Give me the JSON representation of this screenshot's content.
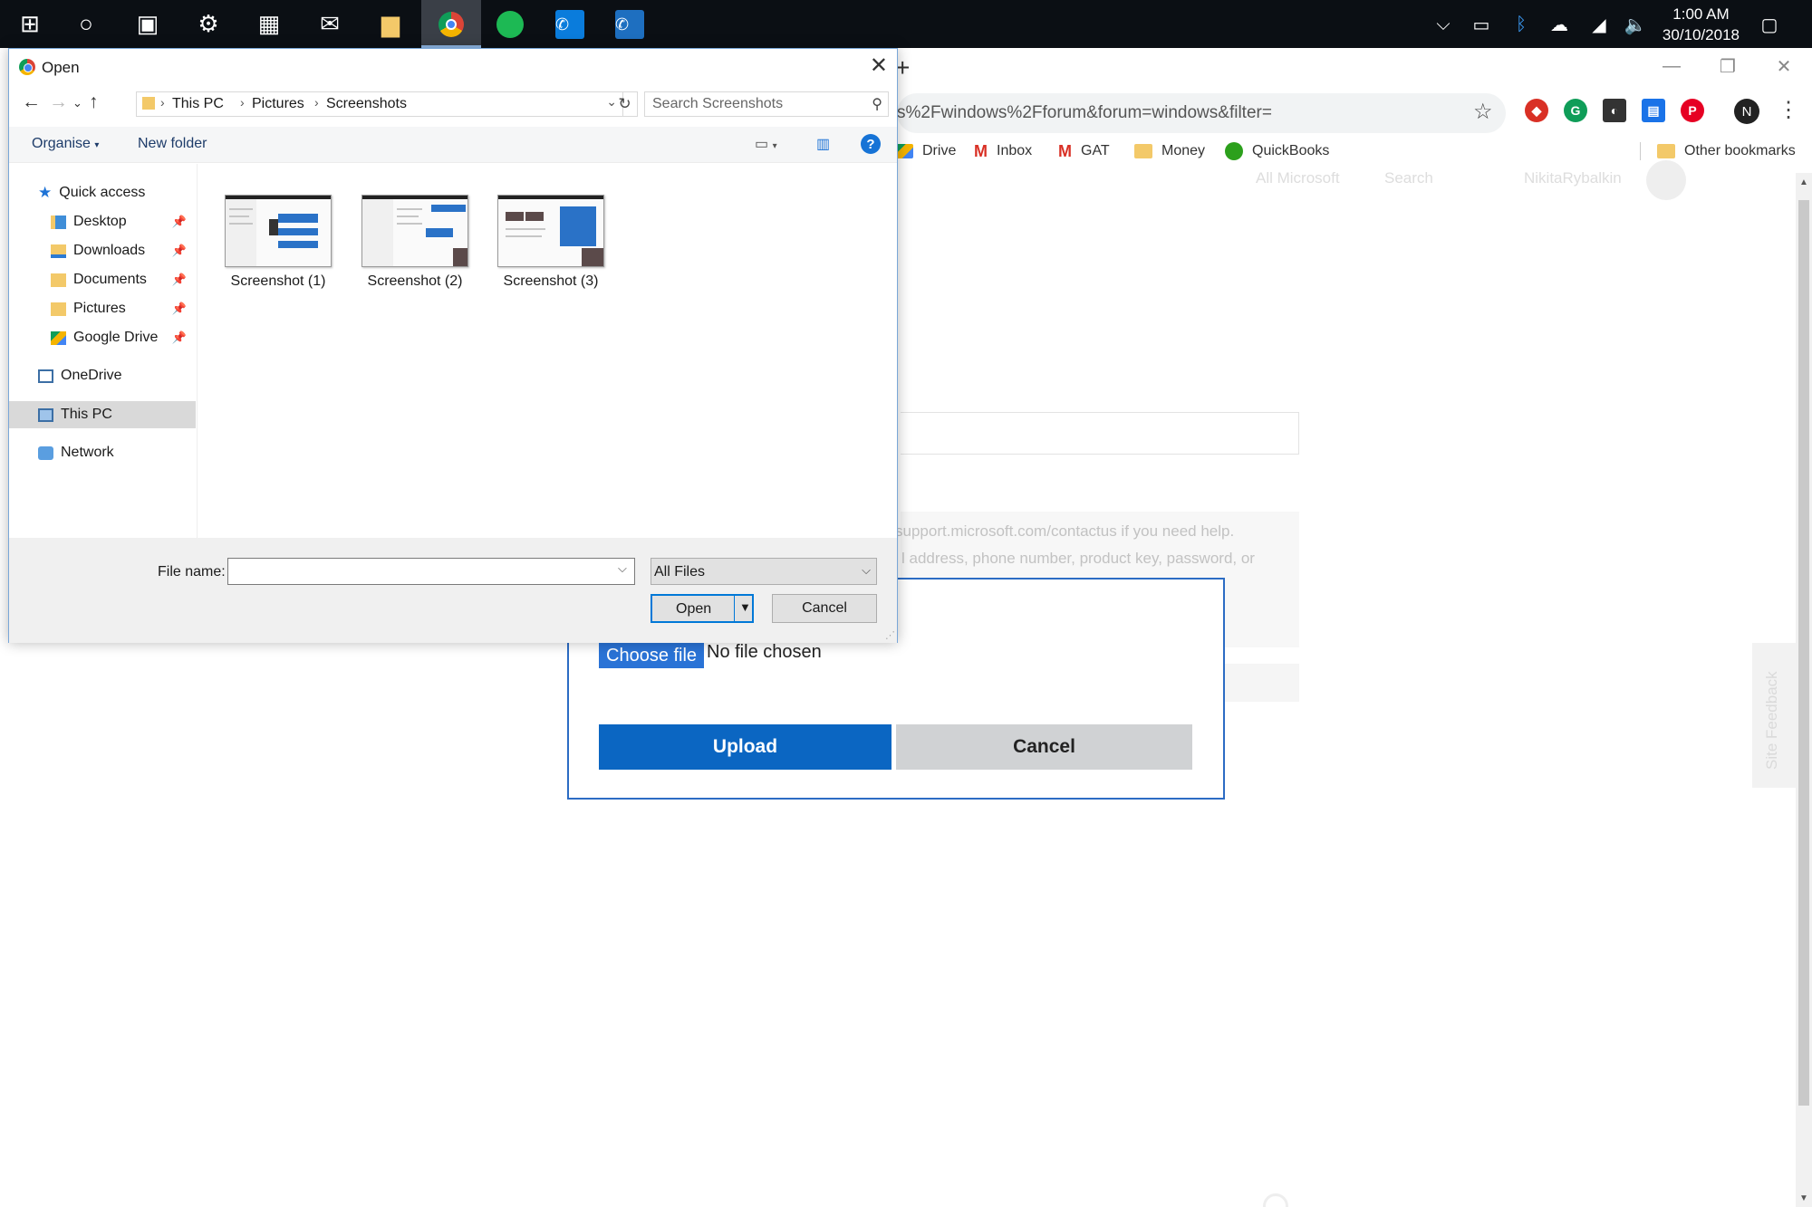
{
  "taskbar": {
    "apps": [
      {
        "name": "windows-start-icon",
        "glyph": "⊞"
      },
      {
        "name": "cortana-icon",
        "glyph": "○"
      },
      {
        "name": "store-icon",
        "glyph": "🛍"
      },
      {
        "name": "settings-icon",
        "glyph": "⚙"
      },
      {
        "name": "calendar-icon",
        "glyph": "▦"
      },
      {
        "name": "mail-icon",
        "glyph": "✉"
      },
      {
        "name": "file-explorer-icon",
        "glyph": "▆"
      },
      {
        "name": "chrome-icon",
        "glyph": "◉"
      },
      {
        "name": "spotify-icon",
        "glyph": "●"
      },
      {
        "name": "messenger-icon",
        "glyph": "✆"
      },
      {
        "name": "whatsapp-icon",
        "glyph": "✆"
      }
    ],
    "clock": {
      "time": "1:00 AM",
      "date": "30/10/2018"
    }
  },
  "browser": {
    "url_fragment": "s%2Fwindows%2Fforum&forum=windows&filter=",
    "avatar_letter": "N",
    "bookmarks": [
      {
        "label": "Drive",
        "icon": "drive-icon"
      },
      {
        "label": "Inbox",
        "icon": "gmail-icon"
      },
      {
        "label": "GAT",
        "icon": "gmail-icon"
      },
      {
        "label": "Money",
        "icon": "folder-icon"
      },
      {
        "label": "QuickBooks",
        "icon": "quickbooks-icon"
      }
    ],
    "other_bookmarks": "Other bookmarks",
    "accent_colors": {
      "extension_red": "#d93025",
      "extension_green": "#0f9d58",
      "extension_blue": "#1a73e8",
      "pinterest": "#e60023"
    }
  },
  "page": {
    "nav_all_microsoft": "All Microsoft",
    "nav_search": "Search",
    "nav_user": "NikitaRybalkin",
    "help_line1": "support.microsoft.com/contactus if you need help.",
    "help_line2": "l address, phone number, product key, password, or",
    "site_feedback": "Site Feedback"
  },
  "upload_dialog": {
    "choose_file": "Choose file",
    "no_file": "No file chosen",
    "upload": "Upload",
    "cancel": "Cancel"
  },
  "open_dialog": {
    "title": "Open",
    "breadcrumb": [
      "This PC",
      "Pictures",
      "Screenshots"
    ],
    "search_placeholder": "Search Screenshots",
    "organise": "Organise",
    "new_folder": "New folder",
    "nav": {
      "quick_access": "Quick access",
      "desktop": "Desktop",
      "downloads": "Downloads",
      "documents": "Documents",
      "pictures": "Pictures",
      "google_drive": "Google Drive",
      "onedrive": "OneDrive",
      "this_pc": "This PC",
      "network": "Network"
    },
    "files": [
      "Screenshot (1)",
      "Screenshot (2)",
      "Screenshot (3)"
    ],
    "file_name_label": "File name:",
    "file_name_value": "",
    "file_type": "All Files",
    "open": "Open",
    "cancel": "Cancel"
  }
}
